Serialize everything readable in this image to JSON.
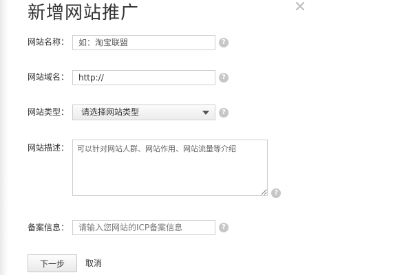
{
  "dialog": {
    "title": "新增网站推广",
    "close_icon": "close-icon"
  },
  "form": {
    "site_name": {
      "label": "网站名称：",
      "value": "",
      "placeholder": "如：淘宝联盟"
    },
    "site_domain": {
      "label": "网站域名：",
      "value": "http://",
      "placeholder": ""
    },
    "site_type": {
      "label": "网站类型：",
      "selected": "请选择网站类型"
    },
    "site_description": {
      "label": "网站描述：",
      "value": "",
      "placeholder": "可以针对网站人群、网站作用、网站流量等介绍"
    },
    "icp_info": {
      "label": "备案信息：",
      "value": "",
      "placeholder": "请输入您网站的ICP备案信息"
    }
  },
  "help_icon": {
    "glyph": "?",
    "name": "question-icon"
  },
  "actions": {
    "next_label": "下一步",
    "cancel_label": "取消"
  },
  "colors": {
    "help_icon_bg": "#c7c7c7",
    "border": "#cfcfcf",
    "text": "#333333"
  }
}
